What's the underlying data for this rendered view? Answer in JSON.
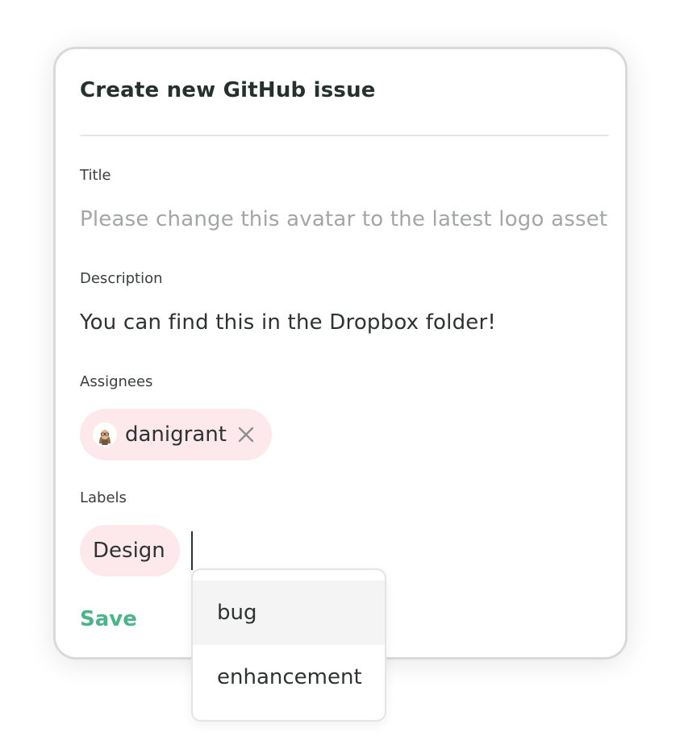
{
  "dialog": {
    "title": "Create new GitHub issue",
    "save_label": "Save"
  },
  "fields": {
    "title": {
      "label": "Title",
      "placeholder": "Please change this avatar to the latest logo asset"
    },
    "description": {
      "label": "Description",
      "value": "You can find this in the Dropbox folder!"
    },
    "assignees": {
      "label": "Assignees",
      "items": [
        {
          "name": "danigrant",
          "avatar_icon": "memoji-avatar",
          "remove_icon": "close-icon"
        }
      ]
    },
    "labels": {
      "label": "Labels",
      "selected": [
        "Design"
      ],
      "suggestions": [
        {
          "label": "bug",
          "highlighted": true
        },
        {
          "label": "enhancement",
          "highlighted": false
        }
      ]
    }
  },
  "colors": {
    "accent": "#4bb48b",
    "pill_bg": "#fde8eb",
    "text": "#2d3331",
    "placeholder": "#a3a6a5",
    "hover_bg": "#f3f4f3"
  }
}
